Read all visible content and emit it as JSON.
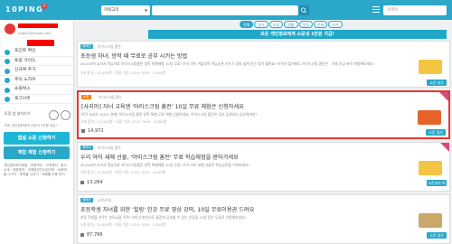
{
  "topbar": {
    "logo": "10PING",
    "notification_count": "0",
    "category": "카테고리",
    "search_placeholder": "",
    "right_search_placeholder": "검색어"
  },
  "sidebar": {
    "email": "mabo1@naver.com",
    "items": [
      {
        "label": "포인트 확인",
        "icon": "points-icon"
      },
      {
        "label": "토핑 가이드",
        "icon": "guide-icon"
      },
      {
        "label": "신규에 추가",
        "icon": "add-icon"
      },
      {
        "label": "주의 노하우",
        "icon": "tips-icon"
      },
      {
        "label": "쇼핑박스",
        "icon": "box-icon"
      },
      {
        "label": "로그아웃",
        "icon": "logout-icon"
      }
    ],
    "app_label": "토핑 앱 설치하기",
    "app_note": "모든 개인정보에게 소문내 1만원 지급!",
    "button_primary": "앱설 소문 신청하기",
    "button_secondary": "체험 체험 신청하기",
    "fine_print": "개인정보처리방침 · 이용약관 · 고객센터 · 회사소개 · 제휴문의 · 이메일무단수집거부 · 소문마을 나가기 · 제목을 고치기 · 매체를 이용 하기"
  },
  "main": {
    "tabs": [
      {
        "label": "전체",
        "active": true
      },
      {
        "label": "광고",
        "active": false
      },
      {
        "label": "쇼핑",
        "active": false
      },
      {
        "label": "생활",
        "active": false
      },
      {
        "label": "맛집",
        "active": false
      },
      {
        "label": "문화",
        "active": false
      },
      {
        "label": "유아",
        "active": false
      }
    ],
    "notice": "모든 개인정보에게 소문내 1만원 지급!",
    "cards": [
      {
        "badge": "캠페인",
        "badge_color": "#2aa7c9",
        "tag": "아이스크림 홈런",
        "title": "초등생 자녀, 방학 때 무료로 공부 시키는 방법",
        "desc": "40,000여 교과서 학습자료 아이스크림홈런 방학 특별체험 10일 무료! 우리 아이 겨울방학 학습습관 키우기 정말 쉽게 하는 법이 뭘까요? 아이가 즐겨봐도 아이스크림 홈런은 . 이제 지금 바로 체험해보세요!",
        "meta": "3개 참가 / 11,000명 · 모집 기간: 2/14~3/20 · 3,000명",
        "count": "",
        "cta": "소문 내기",
        "cta_color": "#2aa7c9",
        "thumb_color": "#f4c542"
      },
      {
        "badge": "쇼핑",
        "badge_color": "#f57c00",
        "tag": "아이스크림 홈런",
        "title": "[사지아] 자녀 교육엔 '아이스크림 홈런' 10일 무료 체험은 신청하세요",
        "desc": "아이 교과서 100% 연계! 아이스크림 홈런 방학 특별 무료 체험 신청하세요. 아이스크림 홈런은 공부 습관부터 공부력까지!",
        "meta": "3개 참가 / 11,000명 · 모집 기간: 2/14~3/20 · 3,000명",
        "count": "14,972",
        "cta": "소문 내기",
        "cta_color": "#2aa7c9",
        "thumb_color": "#e8632b",
        "highlighted": true
      },
      {
        "badge": "캠페인",
        "badge_color": "#2aa7c9",
        "tag": "아이스크림 홈런",
        "title": "우리 아이 새해 선물, '아이스크림 홈런' 무료 학습체험을 받아가세요",
        "desc": "40,000여 교과서 학습자료 아이스크림홈런 방학 특별체험 10일 무료! 우리 아이 새해 선물로 학습습관을 키워보세요!",
        "meta": "3개 참가 / 11,000명 · 모집 기간: 2/14~3/20 · 3,000명",
        "count": "13,284",
        "cta": "소문내지 하기",
        "cta_color": "#2aa7c9",
        "thumb_color": "#f4c542"
      },
      {
        "badge": "캠페인",
        "badge_color": "#2aa7c9",
        "tag": "교육/아동",
        "title": "초등학생 자녀를 위한 '힐링' 인강 무료 영상 강의, 10일 무료이용권 드려요",
        "desc": "초등 학생을 키우는 부모님들 주목! 아이가 혼자서도 즐겁게 공부할 수 있는 인강을 10일 동안 무료로 이용해보세요!",
        "meta": "3개 참가 / 11,000명 · 모집 기간: 2/14~3/20 · 3,000명",
        "count": "87,786",
        "cta": "소문 내기",
        "cta_color": "#2aa7c9",
        "thumb_color": "#c9a86a"
      }
    ]
  }
}
